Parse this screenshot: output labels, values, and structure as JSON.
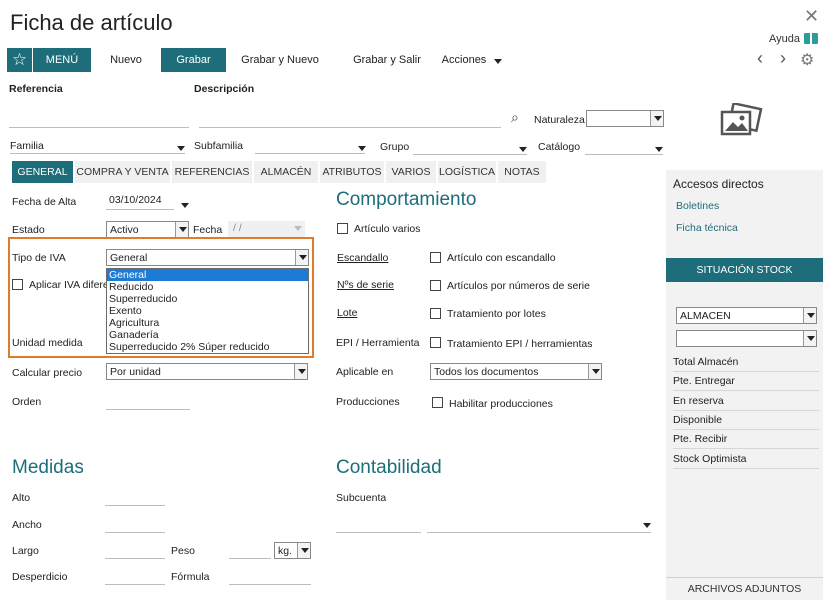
{
  "window": {
    "title": "Ficha de artículo",
    "help": "Ayuda"
  },
  "toolbar": {
    "menu": "MENÚ",
    "nuevo": "Nuevo",
    "grabar": "Grabar",
    "grabar_nuevo": "Grabar y Nuevo",
    "grabar_salir": "Grabar y Salir",
    "acciones": "Acciones"
  },
  "header_fields": {
    "referencia": "Referencia",
    "descripcion": "Descripción",
    "naturaleza": "Naturaleza",
    "familia": "Familia",
    "subfamilia": "Subfamilia",
    "grupo": "Grupo",
    "catalogo": "Catálogo"
  },
  "tabs": [
    {
      "label": "GENERAL"
    },
    {
      "label": "COMPRA Y VENTA"
    },
    {
      "label": "REFERENCIAS"
    },
    {
      "label": "ALMACÉN"
    },
    {
      "label": "ATRIBUTOS"
    },
    {
      "label": "VARIOS"
    },
    {
      "label": "LOGÍSTICA"
    },
    {
      "label": "NOTAS"
    }
  ],
  "general": {
    "fecha_alta_label": "Fecha de Alta",
    "fecha_alta_value": "03/10/2024",
    "estado_label": "Estado",
    "estado_value": "Activo",
    "fecha_label": "Fecha",
    "fecha_value": "/ /",
    "tipo_iva_label": "Tipo de IVA",
    "tipo_iva_value": "General",
    "aplicar_iva_label": "Aplicar IVA difere",
    "unidad_medida_label": "Unidad medida",
    "calcular_precio_label": "Calcular precio",
    "calcular_precio_value": "Por unidad",
    "orden_label": "Orden",
    "iva_options": [
      "General",
      "Reducido",
      "Superreducido",
      "Exento",
      "Agricultura",
      "Ganadería",
      "Superreducido 2% Súper reducido"
    ]
  },
  "comportamiento": {
    "title": "Comportamiento",
    "articulo_varios": "Artículo varios",
    "escandallo": "Escandallo",
    "articulo_escandallo": "Artículo con escandallo",
    "n_serie": "Nºs de serie",
    "articulos_serie": "Artículos por números de serie",
    "lote": "Lote",
    "tratamiento_lotes": "Tratamiento por lotes",
    "epi": "EPI / Herramienta",
    "tratamiento_epi": "Tratamiento EPI / herramientas",
    "aplicable_en": "Aplicable en",
    "aplicable_value": "Todos los documentos",
    "producciones": "Producciones",
    "habilitar_producciones": "Habilitar producciones"
  },
  "medidas": {
    "title": "Medidas",
    "alto": "Alto",
    "ancho": "Ancho",
    "largo": "Largo",
    "peso": "Peso",
    "peso_unit": "kg.",
    "desperdicio": "Desperdicio",
    "formula": "Fórmula"
  },
  "contabilidad": {
    "title": "Contabilidad",
    "subcuenta": "Subcuenta"
  },
  "right_panel": {
    "accesos": "Accesos directos",
    "boletines": "Boletines",
    "ficha_tecnica": "Ficha técnica",
    "situacion_stock": "SITUACIÓN STOCK",
    "almacen_value": "ALMACEN",
    "stock_rows": [
      "Total Almacén",
      "Pte. Entregar",
      "En reserva",
      "Disponible",
      "Pte. Recibir",
      "Stock Optimista"
    ],
    "archivos": "ARCHIVOS ADJUNTOS"
  },
  "colors": {
    "accent": "#1d6e7a",
    "highlight": "#1c7bd4",
    "focus_border": "#e07b28"
  }
}
